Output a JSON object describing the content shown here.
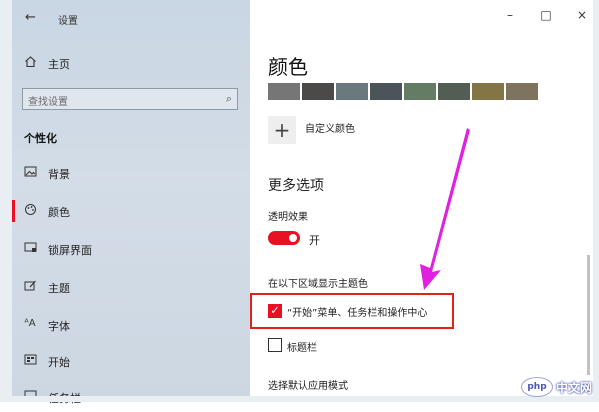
{
  "window": {
    "title": "设置",
    "controls": {
      "minimize": "–",
      "maximize": "□",
      "close": "×"
    }
  },
  "sidebar": {
    "home_label": "主页",
    "search_placeholder": "查找设置",
    "section_title": "个性化",
    "items": [
      {
        "label": "背景",
        "icon": "image-icon"
      },
      {
        "label": "颜色",
        "icon": "palette-icon",
        "active": true
      },
      {
        "label": "锁屏界面",
        "icon": "lock-screen-icon"
      },
      {
        "label": "主题",
        "icon": "theme-icon"
      },
      {
        "label": "字体",
        "icon": "font-icon"
      },
      {
        "label": "开始",
        "icon": "start-icon"
      },
      {
        "label": "任务栏",
        "icon": "taskbar-icon"
      }
    ]
  },
  "main": {
    "title": "颜色",
    "swatches": [
      "#767676",
      "#4c4a48",
      "#69797e",
      "#4a5459",
      "#647c64",
      "#525e54",
      "#847545",
      "#7e735f"
    ],
    "custom_color_label": "自定义颜色",
    "more_options_title": "更多选项",
    "transparency": {
      "label": "透明效果",
      "state": "开",
      "on": true
    },
    "accent_surfaces_label": "在以下区域显示主题色",
    "checkboxes": [
      {
        "label": "“开始”菜单、任务栏和操作中心",
        "checked": true
      },
      {
        "label": "标题栏",
        "checked": false
      }
    ],
    "app_mode_label": "选择默认应用模式"
  },
  "accent_color": "#e81123",
  "annotation_color": "#e021e0",
  "watermark": {
    "logo": "php",
    "text": "中文网"
  }
}
